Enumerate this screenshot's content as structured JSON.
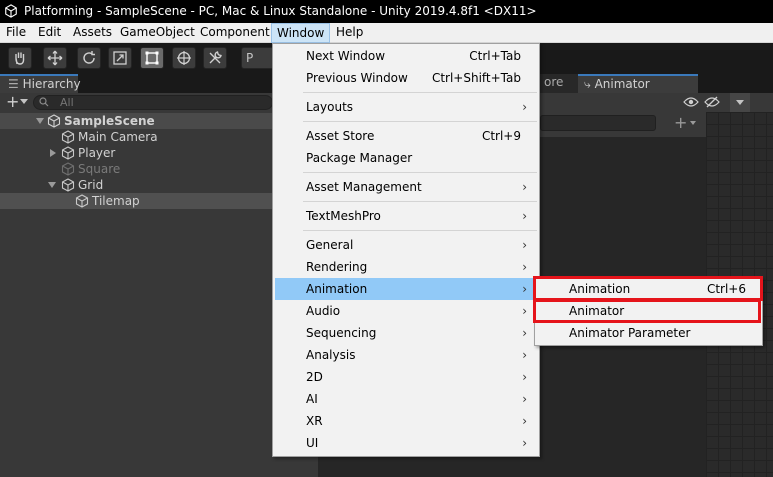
{
  "window_title": "Platforming - SampleScene - PC, Mac & Linux Standalone - Unity 2019.4.8f1 <DX11>",
  "menubar": [
    "File",
    "Edit",
    "Assets",
    "GameObject",
    "Component",
    "Window",
    "Help"
  ],
  "active_menu": "Window",
  "toolbar": {
    "tools": [
      "hand-tool",
      "move-tool",
      "rotate-tool",
      "scale-tool",
      "rect-tool",
      "transform-tool",
      "custom-tool"
    ],
    "pivot_label": "P"
  },
  "hierarchy": {
    "tab_label": "Hierarchy",
    "add_label": "+",
    "search_placeholder": "All",
    "rows": [
      {
        "label": "SampleScene"
      },
      {
        "label": "Main Camera"
      },
      {
        "label": "Player"
      },
      {
        "label": "Square"
      },
      {
        "label": "Grid"
      },
      {
        "label": "Tilemap"
      }
    ],
    "kebab": "⋮"
  },
  "right_tabs": {
    "partial_tab": "ore",
    "animator_tab": "Animator"
  },
  "window_menu": {
    "items": [
      {
        "label": "Next Window",
        "shortcut": "Ctrl+Tab"
      },
      {
        "label": "Previous Window",
        "shortcut": "Ctrl+Shift+Tab"
      },
      {
        "label": "Layouts",
        "arrow": "›"
      },
      {
        "label": "Asset Store",
        "shortcut": "Ctrl+9"
      },
      {
        "label": "Package Manager"
      },
      {
        "label": "Asset Management",
        "arrow": "›"
      },
      {
        "label": "TextMeshPro",
        "arrow": "›"
      },
      {
        "label": "General",
        "arrow": "›"
      },
      {
        "label": "Rendering",
        "arrow": "›"
      },
      {
        "label": "Animation",
        "arrow": "›"
      },
      {
        "label": "Audio",
        "arrow": "›"
      },
      {
        "label": "Sequencing",
        "arrow": "›"
      },
      {
        "label": "Analysis",
        "arrow": "›"
      },
      {
        "label": "2D",
        "arrow": "›"
      },
      {
        "label": "AI",
        "arrow": "›"
      },
      {
        "label": "XR",
        "arrow": "›"
      },
      {
        "label": "UI",
        "arrow": "›"
      }
    ]
  },
  "animation_submenu": {
    "items": [
      {
        "label": "Animation",
        "shortcut": "Ctrl+6"
      },
      {
        "label": "Animator"
      },
      {
        "label": "Animator Parameter"
      }
    ]
  },
  "colors": {
    "highlight": "#91c9f7",
    "annotation_red": "#e5141b",
    "tab_accent": "#3a79bb"
  }
}
